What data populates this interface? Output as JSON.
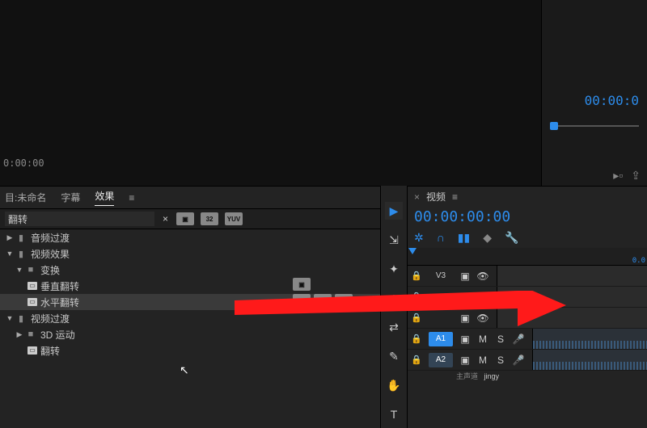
{
  "source": {
    "time": "0:00:00"
  },
  "program": {
    "time": "00:00:0"
  },
  "panels": {
    "project_label": "目:未命名",
    "caption_label": "字幕",
    "effects_label": "效果"
  },
  "search": {
    "value": "翻转"
  },
  "badges": {
    "b32": "32",
    "byuv": "YUV"
  },
  "tree": {
    "audio_transitions": "音频过渡",
    "video_effects": "视频效果",
    "transform": "变换",
    "vert_flip": "垂直翻转",
    "horiz_flip": "水平翻转",
    "video_transitions": "视频过渡",
    "motion3d": "3D 运动",
    "flip": "翻转"
  },
  "timeline": {
    "title": "视频",
    "time": "00:00:00:00",
    "zero": "0.0",
    "tracks": {
      "v3": "V3",
      "a1": "A1",
      "a2": "A2",
      "a_sub": "A1",
      "m": "M",
      "s": "S",
      "master": "主声道"
    }
  },
  "watermark": "jingy"
}
